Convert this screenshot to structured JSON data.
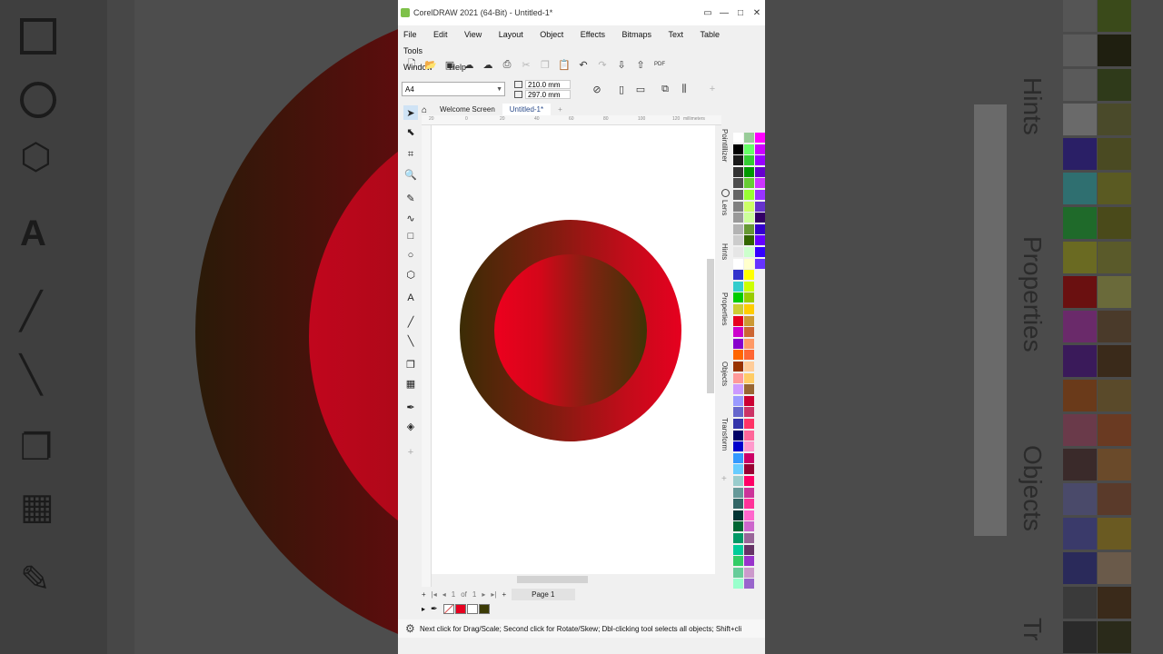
{
  "window": {
    "title": "CorelDRAW 2021 (64-Bit) - Untitled-1*",
    "controls": [
      "▭",
      "—",
      "□",
      "✕"
    ]
  },
  "menu": [
    {
      "label": "File"
    },
    {
      "label": "Edit"
    },
    {
      "label": "View"
    },
    {
      "label": "Layout"
    },
    {
      "label": "Object"
    },
    {
      "label": "Effects"
    },
    {
      "label": "Bitmaps"
    },
    {
      "label": "Text"
    },
    {
      "label": "Table"
    },
    {
      "label": "Tools"
    },
    {
      "label": "Window"
    },
    {
      "label": "Help"
    }
  ],
  "property_bar": {
    "page_size": "A4",
    "width": "210.0 mm",
    "height": "297.0 mm"
  },
  "tabs": {
    "welcome": "Welcome Screen",
    "document": "Untitled-1*",
    "add": "+"
  },
  "ruler": {
    "units": "millimeters",
    "h_ticks": [
      "20",
      "0",
      "20",
      "40",
      "60",
      "80",
      "100",
      "120"
    ]
  },
  "page_nav": {
    "position": "1",
    "of_label": "of",
    "total": "1",
    "page_label": "Page 1"
  },
  "dockers": [
    "Pointillizer",
    "Lens",
    "Hints",
    "Properties",
    "Objects",
    "Transform"
  ],
  "status_text": "Next click for Drag/Scale; Second click for Rotate/Skew; Dbl-clicking tool selects all objects; Shift+cli",
  "fill_colors": {
    "outer_gradient": [
      "#3b2c05",
      "#e6001f"
    ],
    "inner_gradient": [
      "#ed001e",
      "#3e3406"
    ]
  },
  "background_labels": {
    "hints": "Hints",
    "properties": "Properties",
    "objects": "Objects",
    "transform": "Tr"
  }
}
